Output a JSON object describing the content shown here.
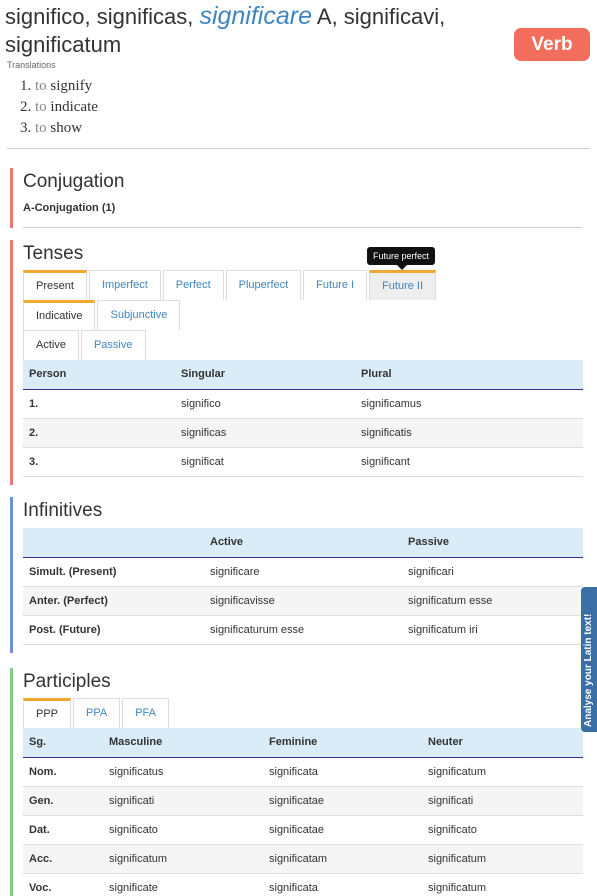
{
  "header": {
    "form1": "significo, significas,",
    "main": "significare",
    "after_main": " A, significavi,",
    "form4": "significatum",
    "badge": "Verb"
  },
  "translations": {
    "label": "Translations",
    "items": [
      {
        "num": "1.",
        "to": "to",
        "word": "signify"
      },
      {
        "num": "2.",
        "to": "to",
        "word": "indicate"
      },
      {
        "num": "3.",
        "to": "to",
        "word": "show"
      }
    ]
  },
  "conjugation": {
    "title": "Conjugation",
    "value": "A-Conjugation (1)"
  },
  "tenses": {
    "title": "Tenses",
    "tooltip": "Future perfect",
    "tense_tabs": [
      "Present",
      "Imperfect",
      "Perfect",
      "Pluperfect",
      "Future I",
      "Future II"
    ],
    "mood_tabs": [
      "Indicative",
      "Subjunctive"
    ],
    "voice_tabs": [
      "Active",
      "Passive"
    ],
    "headers": [
      "Person",
      "Singular",
      "Plural"
    ],
    "rows": [
      [
        "1.",
        "significo",
        "significamus"
      ],
      [
        "2.",
        "significas",
        "significatis"
      ],
      [
        "3.",
        "significat",
        "significant"
      ]
    ]
  },
  "infinitives": {
    "title": "Infinitives",
    "headers": [
      "",
      "Active",
      "Passive"
    ],
    "rows": [
      [
        "Simult. (Present)",
        "significare",
        "significari"
      ],
      [
        "Anter. (Perfect)",
        "significavisse",
        "significatum esse"
      ],
      [
        "Post. (Future)",
        "significaturum esse",
        "significatum iri"
      ]
    ]
  },
  "participles": {
    "title": "Participles",
    "tabs": [
      "PPP",
      "PPA",
      "PFA"
    ],
    "headers": [
      "Sg.",
      "Masculine",
      "Feminine",
      "Neuter"
    ],
    "rows": [
      [
        "Nom.",
        "significatus",
        "significata",
        "significatum"
      ],
      [
        "Gen.",
        "significati",
        "significatae",
        "significati"
      ],
      [
        "Dat.",
        "significato",
        "significatae",
        "significato"
      ],
      [
        "Acc.",
        "significatum",
        "significatam",
        "significatum"
      ],
      [
        "Voc.",
        "significate",
        "significata",
        "significatum"
      ]
    ]
  },
  "side_tab": {
    "label": "Analyse your Latin text!"
  },
  "colors": {
    "accent": "#3f86c0",
    "badge": "#f26d5b",
    "tab_active": "#f0a830"
  }
}
